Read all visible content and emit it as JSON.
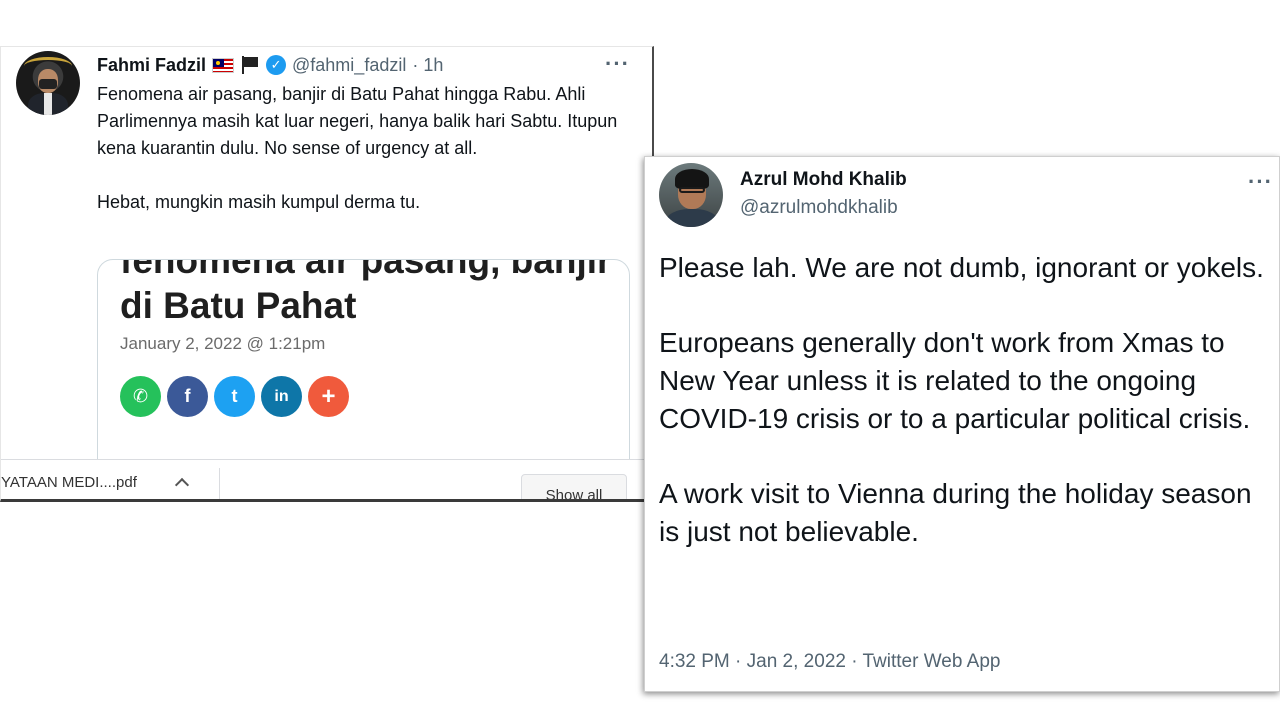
{
  "tweet1": {
    "name": "Fahmi Fadzil",
    "handle": "@fahmi_fadzil",
    "time": "· 1h",
    "more_label": "···",
    "verified_mark": "✓",
    "icons": [
      "malaysia-flag-icon",
      "black-flag-icon",
      "verified-badge-icon",
      "more-options-icon"
    ],
    "text": [
      "Fenomena air pasang, banjir di Batu Pahat hingga Rabu. Ahli Parlimennya masih kat luar negeri, hanya balik hari Sabtu. Itupun kena kuarantin dulu. No sense of urgency at all.",
      "Hebat, mungkin masih kumpul derma tu."
    ],
    "card": {
      "headline": "fenomena air pasang, banjir di Batu Pahat",
      "date": "January 2, 2022 @ 1:21pm",
      "share_buttons": [
        {
          "icon": "whatsapp-icon",
          "glyph": "✆",
          "color": "#25c15b"
        },
        {
          "icon": "facebook-icon",
          "glyph": "f",
          "color": "#3b5998"
        },
        {
          "icon": "twitter-icon",
          "glyph": "t",
          "color": "#1da1f2"
        },
        {
          "icon": "linkedin-icon",
          "glyph": "in",
          "color": "#0e76a8"
        },
        {
          "icon": "more-share-icon",
          "glyph": "+",
          "color": "#f05a3c"
        }
      ]
    },
    "download_bar": {
      "file_label": "YATAAN MEDI....pdf",
      "show_all_label": "Show all"
    }
  },
  "tweet2": {
    "name": "Azrul Mohd Khalib",
    "handle": "@azrulmohdkhalib",
    "more_label": "···",
    "text": [
      "Please lah. We are not dumb, ignorant or yokels.",
      "Europeans generally don't work from Xmas to New Year unless it is related to the ongoing COVID-19 crisis or to a particular political crisis.",
      "A work visit to Vienna during the holiday season is just not believable."
    ],
    "meta": "4:32 PM · Jan 2, 2022 · Twitter Web App"
  }
}
